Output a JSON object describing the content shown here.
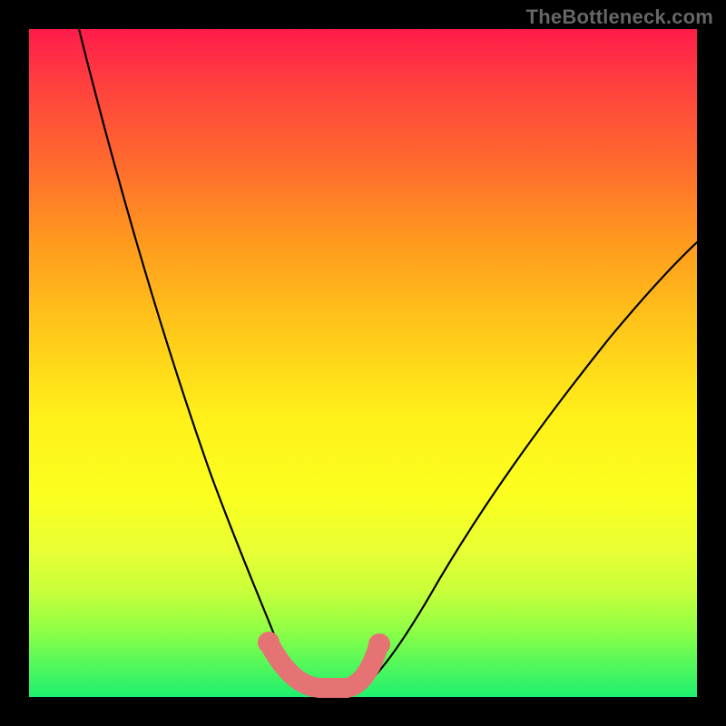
{
  "watermark": "TheBottleneck.com",
  "chart_data": {
    "type": "line",
    "title": "",
    "xlabel": "",
    "ylabel": "",
    "xlim": [
      0,
      100
    ],
    "ylim": [
      0,
      100
    ],
    "grid": false,
    "legend": false,
    "series": [
      {
        "name": "left-curve",
        "x": [
          8,
          12,
          16,
          20,
          24,
          28,
          31,
          33,
          35,
          37,
          38.5
        ],
        "values": [
          100,
          78,
          58,
          42,
          30,
          20,
          12,
          8,
          5,
          3,
          2
        ]
      },
      {
        "name": "right-curve",
        "x": [
          50,
          52,
          55,
          59,
          64,
          71,
          79,
          88,
          100
        ],
        "values": [
          2,
          4,
          8,
          14,
          22,
          32,
          44,
          55,
          68
        ]
      },
      {
        "name": "bottom-highlight",
        "x": [
          34,
          38,
          42,
          46,
          50
        ],
        "values": [
          5,
          2,
          1.5,
          2,
          5
        ]
      }
    ],
    "annotations": [
      {
        "name": "left-dot",
        "x": 34,
        "y": 6
      },
      {
        "name": "right-dot",
        "x": 50,
        "y": 6
      }
    ],
    "colors": {
      "background_gradient_top": "#ff1b4a",
      "background_gradient_bottom": "#1ef06e",
      "curve": "#000000",
      "highlight": "#e57373"
    }
  }
}
